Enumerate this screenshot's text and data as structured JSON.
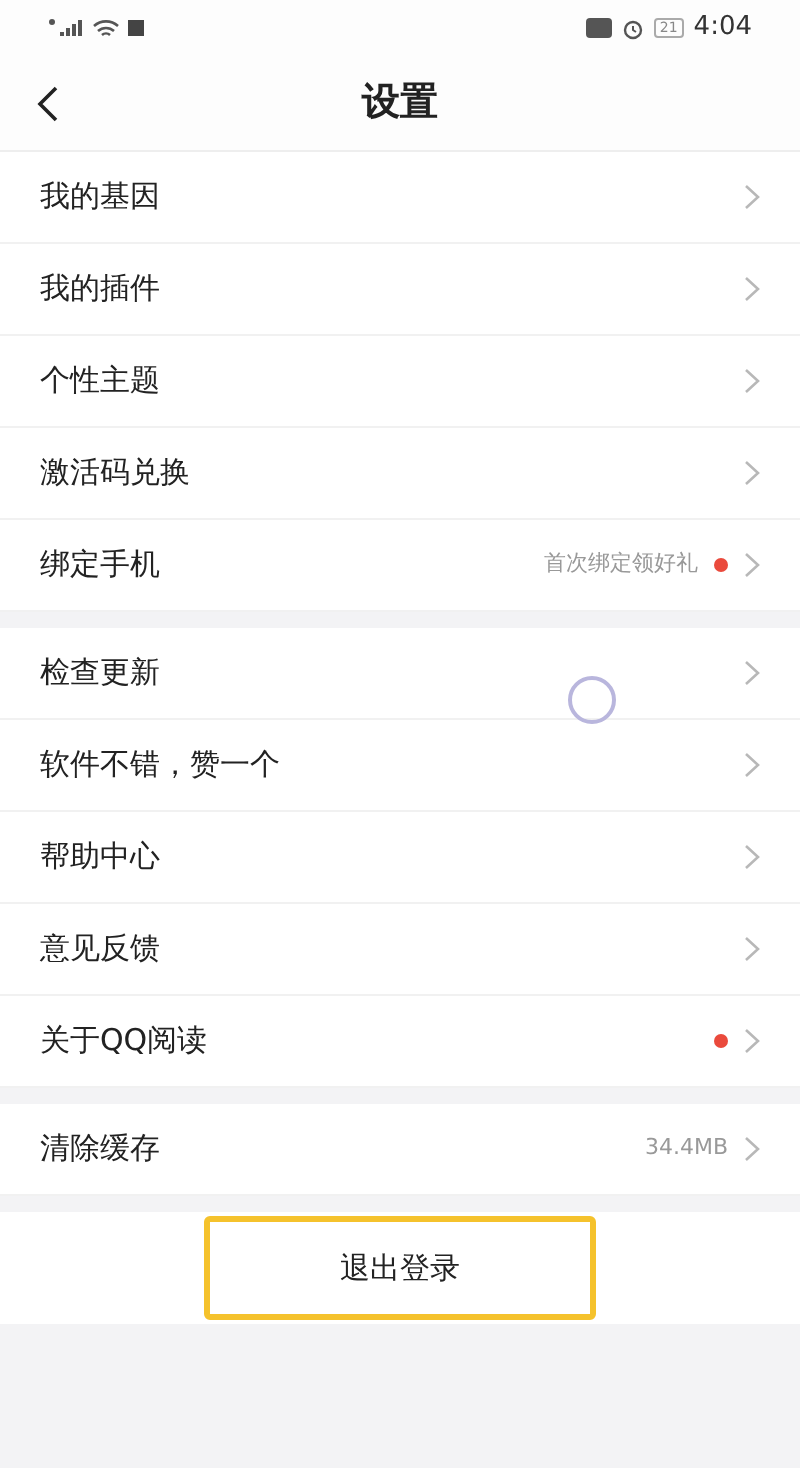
{
  "status_bar": {
    "time": "4:04",
    "battery": "21"
  },
  "header": {
    "title": "设置"
  },
  "groups": [
    {
      "items": [
        {
          "label": "我的基因",
          "dot": false
        },
        {
          "label": "我的插件",
          "dot": false
        },
        {
          "label": "个性主题",
          "dot": false
        },
        {
          "label": "激活码兑换",
          "dot": false
        },
        {
          "label": "绑定手机",
          "hint": "首次绑定领好礼",
          "dot": true
        }
      ]
    },
    {
      "items": [
        {
          "label": "检查更新",
          "dot": false
        },
        {
          "label": "软件不错，赞一个",
          "dot": false
        },
        {
          "label": "帮助中心",
          "dot": false
        },
        {
          "label": "意见反馈",
          "dot": false
        },
        {
          "label": "关于QQ阅读",
          "dot": true
        }
      ]
    },
    {
      "items": [
        {
          "label": "清除缓存",
          "hint": "34.4MB",
          "dot": false
        }
      ]
    }
  ],
  "logout": {
    "label": "退出登录"
  }
}
